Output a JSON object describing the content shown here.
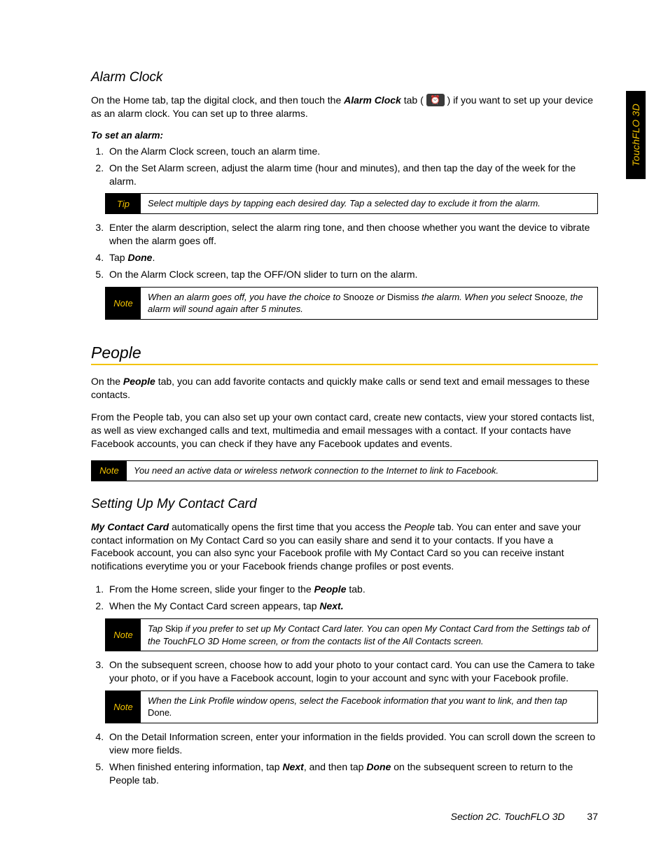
{
  "sideTab": "TouchFLO 3D",
  "sections": {
    "alarm": {
      "heading": "Alarm Clock",
      "intro_pre": "On the Home tab, tap the digital clock, and then touch the ",
      "intro_bi": "Alarm Clock",
      "intro_mid": " tab ( ",
      "intro_post": " ) if you want to set up your device as an alarm clock. You can set up to three alarms.",
      "procIntro": "To set an alarm:",
      "step1": "On the Alarm Clock screen, touch an alarm time.",
      "step2": "On the Set Alarm screen, adjust the alarm time (hour and minutes), and then tap the day of the week for the alarm.",
      "tipLabel": "Tip",
      "tipText": "Select multiple days by tapping each desired day. Tap a selected day to exclude it from the alarm.",
      "step3": "Enter the alarm description, select the alarm ring tone, and then choose whether you want the device to vibrate when the alarm goes off.",
      "step4_pre": "Tap ",
      "step4_bi": "Done",
      "step4_post": ".",
      "step5": "On the Alarm Clock screen, tap the OFF/ON slider to turn on the alarm.",
      "noteLabel": "Note",
      "note_a": "When an alarm goes off, you have the choice to ",
      "note_b": "Snooze",
      "note_c": " or ",
      "note_d": "Dismiss",
      "note_e": " the alarm. When you select ",
      "note_f": "Snooze",
      "note_g": ", the alarm will sound again after 5 minutes."
    },
    "people": {
      "heading": "People",
      "p1_a": "On the ",
      "p1_b": "People",
      "p1_c": " tab, you can add favorite contacts and quickly make calls or send text and email messages to these contacts.",
      "p2": "From the People tab, you can also set up your own contact card, create new contacts, view your stored contacts list, as well as view exchanged calls and text, multimedia and email messages with a contact. If your contacts have Facebook accounts, you can check if they have any Facebook updates and events.",
      "noteLabel": "Note",
      "noteText": "You need an active data or wireless network connection to the Internet to link to Facebook."
    },
    "contactCard": {
      "heading": "Setting Up My Contact Card",
      "p1_a": "My Contact Card",
      "p1_b": " automatically opens the first time that you access the ",
      "p1_c": "People",
      "p1_d": " tab. You can enter and save your contact information on My Contact Card so you can easily share and send it to your contacts. If you have a Facebook account, you can also sync your Facebook profile with My Contact Card so you can receive instant notifications everytime you or your Facebook friends change profiles or post events.",
      "step1_a": "From the Home screen, slide your finger to the ",
      "step1_b": "People",
      "step1_c": " tab.",
      "step2_a": "When the My Contact Card screen appears, tap ",
      "step2_b": "Next.",
      "note1Label": "Note",
      "note1_a": "Tap ",
      "note1_b": "Skip",
      "note1_c": " if you prefer to set up My Contact Card later. You can open My Contact Card from the Settings tab of the TouchFLO 3D Home screen, or from the contacts list of the All Contacts screen.",
      "step3": "On the subsequent screen, choose how to add your photo to your contact card. You can use the Camera to take your photo, or if you have a Facebook account, login to your account and sync with your Facebook profile.",
      "note2Label": "Note",
      "note2_a": "When the Link Profile window opens, select the Facebook information that you want to link, and then tap ",
      "note2_b": "Done",
      "note2_c": ".",
      "step4": "On the Detail Information screen, enter your information in the fields provided. You can scroll down the screen to view more fields.",
      "step5_a": "When finished entering information, tap ",
      "step5_b": "Next",
      "step5_c": ", and then tap ",
      "step5_d": "Done",
      "step5_e": " on the subsequent screen to return to the People tab."
    }
  },
  "footer": {
    "section": "Section 2C. TouchFLO 3D",
    "page": "37"
  }
}
